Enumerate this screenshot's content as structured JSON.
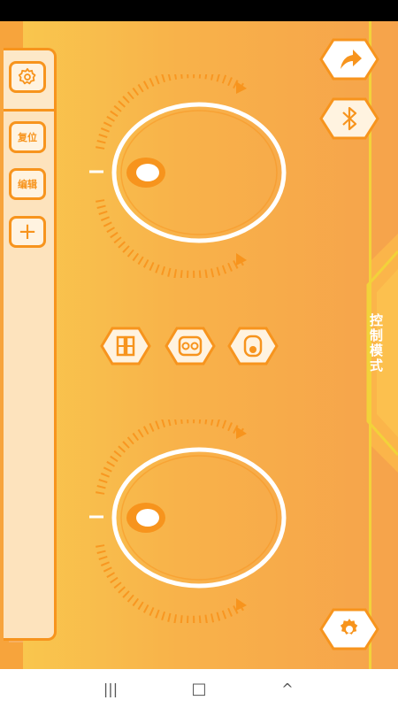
{
  "left_panel": {
    "reset_label": "复位",
    "edit_label": "编辑",
    "add_label": "+"
  },
  "right_panel": {
    "mode_label": "控制模式"
  },
  "icons": {
    "settings_top": "gear-icon",
    "action": "arrow-icon",
    "bluetooth": "bluetooth-icon",
    "settings_bottom": "gear-icon"
  },
  "mode_buttons": [
    "tank-mode-icon",
    "car-mode-icon",
    "joystick-mode-icon"
  ],
  "colors": {
    "accent": "#f7941d",
    "track": "#fde3bd",
    "rail": "#f2d23a"
  },
  "nav": {
    "recents": "|||",
    "home": "□",
    "back": "^"
  }
}
